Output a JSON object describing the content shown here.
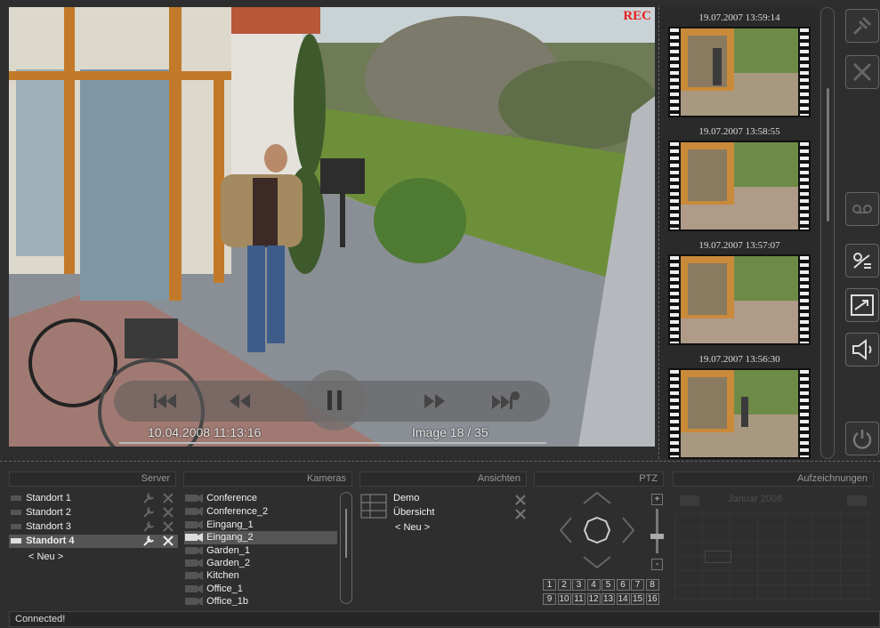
{
  "video": {
    "rec_label": "REC",
    "timestamp": "10.04.2008 11:13:16",
    "image_counter": "Image 18 / 35"
  },
  "thumbnails": [
    {
      "timestamp": "19.07.2007 13:59:14"
    },
    {
      "timestamp": "19.07.2007 13:58:55"
    },
    {
      "timestamp": "19.07.2007 13:57:07"
    },
    {
      "timestamp": "19.07.2007 13:56:30"
    }
  ],
  "toolbar": {
    "icons": [
      "plug-icon",
      "tools-icon",
      "tape-icon",
      "network-icon",
      "resize-icon",
      "speaker-icon",
      "power-icon"
    ]
  },
  "server": {
    "header": "Server",
    "items": [
      {
        "label": "Standort 1"
      },
      {
        "label": "Standort 2"
      },
      {
        "label": "Standort 3"
      },
      {
        "label": "Standort 4"
      }
    ],
    "new_label": "< Neu >"
  },
  "cameras": {
    "header": "Kameras",
    "items": [
      {
        "label": "Conference"
      },
      {
        "label": "Conference_2"
      },
      {
        "label": "Eingang_1"
      },
      {
        "label": "Eingang_2"
      },
      {
        "label": "Garden_1"
      },
      {
        "label": "Garden_2"
      },
      {
        "label": "Kitchen"
      },
      {
        "label": "Office_1"
      },
      {
        "label": "Office_1b"
      }
    ]
  },
  "views": {
    "header": "Ansichten",
    "items": [
      {
        "label": "Demo"
      },
      {
        "label": "Übersicht"
      }
    ],
    "new_label": "< Neu >"
  },
  "ptz": {
    "header": "PTZ",
    "presets": [
      "1",
      "2",
      "3",
      "4",
      "5",
      "6",
      "7",
      "8",
      "9",
      "10",
      "11",
      "12",
      "13",
      "14",
      "15",
      "16"
    ],
    "zoom_in": "+",
    "zoom_out": "-"
  },
  "recordings": {
    "header": "Aufzeichnungen",
    "month": "Januar 2008"
  },
  "status": {
    "text": "Connected!"
  }
}
